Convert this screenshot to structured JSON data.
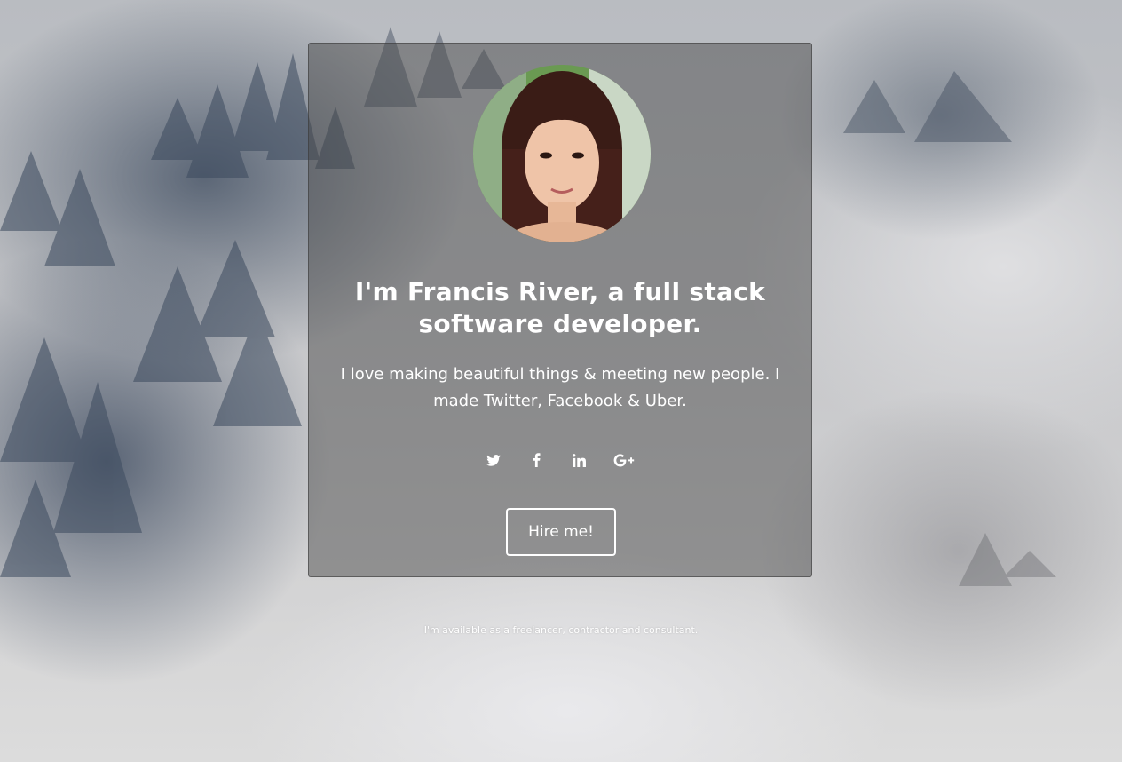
{
  "profile": {
    "photo_alt": "Profile photo",
    "headline": "I'm Francis River, a full stack software developer.",
    "bio": "I love making beautiful things & meeting new people. I made Twitter, Facebook & Uber."
  },
  "social": [
    {
      "name": "Twitter",
      "icon": "twitter-icon"
    },
    {
      "name": "Facebook",
      "icon": "facebook-icon"
    },
    {
      "name": "LinkedIn",
      "icon": "linkedin-icon"
    },
    {
      "name": "Google Plus",
      "icon": "google-plus-icon"
    }
  ],
  "cta": {
    "label": "Hire me!"
  },
  "footer": {
    "note": "I'm available as a freelancer, contractor and consultant."
  }
}
